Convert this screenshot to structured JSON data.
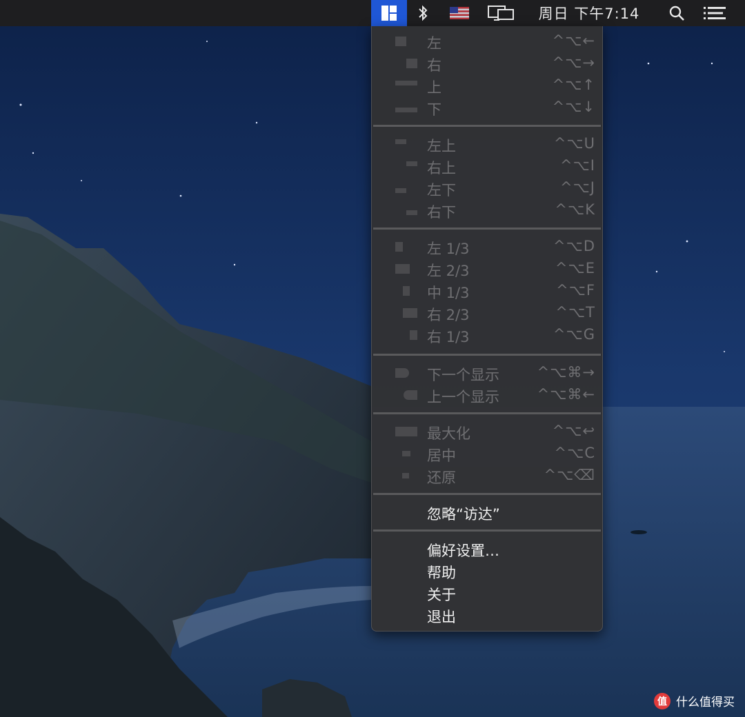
{
  "menubar": {
    "clock": "周日 下午7:14",
    "icons": [
      "rectangle-app-icon",
      "bluetooth-icon",
      "us-flag-icon",
      "display-mirror-icon",
      "search-icon",
      "notification-list-icon"
    ]
  },
  "menu": {
    "items": [
      {
        "label": "左",
        "key": "^⌥←"
      },
      {
        "label": "右",
        "key": "^⌥→"
      },
      {
        "label": "上",
        "key": "^⌥↑"
      },
      {
        "label": "下",
        "key": "^⌥↓"
      },
      {
        "label": "左上",
        "key": "^⌥U"
      },
      {
        "label": "右上",
        "key": "^⌥I"
      },
      {
        "label": "左下",
        "key": "^⌥J"
      },
      {
        "label": "右下",
        "key": "^⌥K"
      },
      {
        "label": "左 1/3",
        "key": "^⌥D"
      },
      {
        "label": "左 2/3",
        "key": "^⌥E"
      },
      {
        "label": "中 1/3",
        "key": "^⌥F"
      },
      {
        "label": "右 2/3",
        "key": "^⌥T"
      },
      {
        "label": "右 1/3",
        "key": "^⌥G"
      },
      {
        "label": "下一个显示",
        "key": "^⌥⌘→"
      },
      {
        "label": "上一个显示",
        "key": "^⌥⌘←"
      },
      {
        "label": "最大化",
        "key": "^⌥↩"
      },
      {
        "label": "居中",
        "key": "^⌥C"
      },
      {
        "label": "还原",
        "key": "^⌥⌫"
      },
      {
        "label": "忽略“访达”"
      },
      {
        "label": "偏好设置…"
      },
      {
        "label": "帮助"
      },
      {
        "label": "关于"
      },
      {
        "label": "退出"
      }
    ]
  },
  "watermark": {
    "badge": "值",
    "text": "什么值得买"
  },
  "colors": {
    "menubar_bg": "#1e1e20",
    "app_icon_highlight": "#1f57d6",
    "menu_bg": "#323234",
    "disabled_text": "#6f6f72",
    "enabled_text": "#f0f0f0"
  }
}
